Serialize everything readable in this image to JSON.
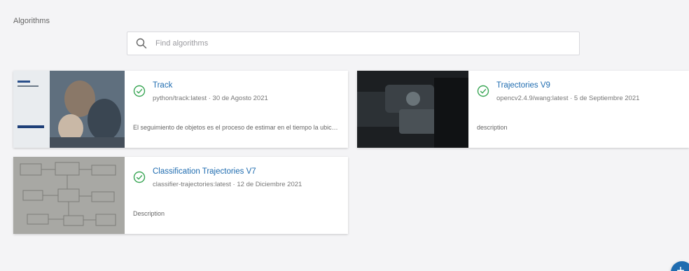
{
  "header": {
    "title": "Algorithms"
  },
  "search": {
    "placeholder": "Find algorithms",
    "value": ""
  },
  "colors": {
    "accent": "#1f6cb0",
    "success": "#3aa655"
  },
  "cards": [
    {
      "name": "Track",
      "meta": "python/track:latest · 30 de Agosto 2021",
      "description": "El seguimiento de objetos es el proceso de estimar en el tiempo la ubicación de uno o más objetos",
      "status_icon": "check-circle-icon"
    },
    {
      "name": "Trajectories V9",
      "meta": "opencv2.4.9/wang:latest · 5 de Septiembre 2021",
      "description": "description",
      "status_icon": "check-circle-icon"
    },
    {
      "name": "Classification Trajectories V7",
      "meta": "classifier-trajectories:latest · 12 de Diciembre 2021",
      "description": "Description",
      "status_icon": "check-circle-icon"
    }
  ],
  "fab": {
    "icon": "plus-icon",
    "label": "+"
  }
}
